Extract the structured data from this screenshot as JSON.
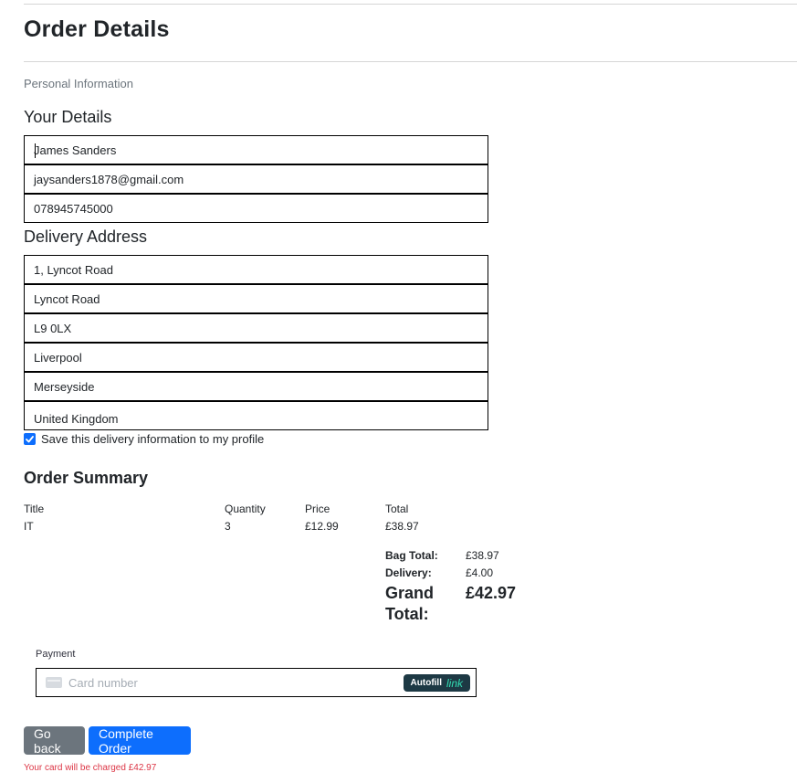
{
  "page": {
    "title": "Order Details",
    "section_caption": "Personal Information"
  },
  "details": {
    "heading": "Your Details",
    "full_name": "James Sanders",
    "email": "jaysanders1878@gmail.com",
    "phone": "078945745000"
  },
  "address": {
    "heading": "Delivery Address",
    "street1": "1, Lyncot Road",
    "street2": "Lyncot Road",
    "postcode": "L9 0LX",
    "town": "Liverpool",
    "county": "Merseyside",
    "country": "United Kingdom",
    "save_label": "Save this delivery information to my profile",
    "save_checked": true
  },
  "summary": {
    "heading": "Order Summary",
    "columns": [
      "Title",
      "Quantity",
      "Price",
      "Total"
    ],
    "rows": [
      {
        "title": "IT",
        "quantity": "3",
        "price": "£12.99",
        "total": "£38.97"
      }
    ],
    "bag_total_label": "Bag Total:",
    "bag_total": "£38.97",
    "delivery_label": "Delivery:",
    "delivery": "£4.00",
    "grand_total_label_line1": "Grand",
    "grand_total_label_line2": "Total:",
    "grand_total": "£42.97"
  },
  "payment": {
    "label": "Payment",
    "card_placeholder": "Card number",
    "autofill_label": "Autofill",
    "autofill_brand": "link"
  },
  "actions": {
    "back_label": "Go back",
    "complete_label": "Complete Order",
    "charge_note": "Your card will be charged £42.97"
  },
  "colors": {
    "primary": "#0d6efd",
    "secondary": "#6c757d",
    "danger": "#dc3545",
    "link_badge": "#1d3944",
    "link_accent": "#33ddb3"
  }
}
